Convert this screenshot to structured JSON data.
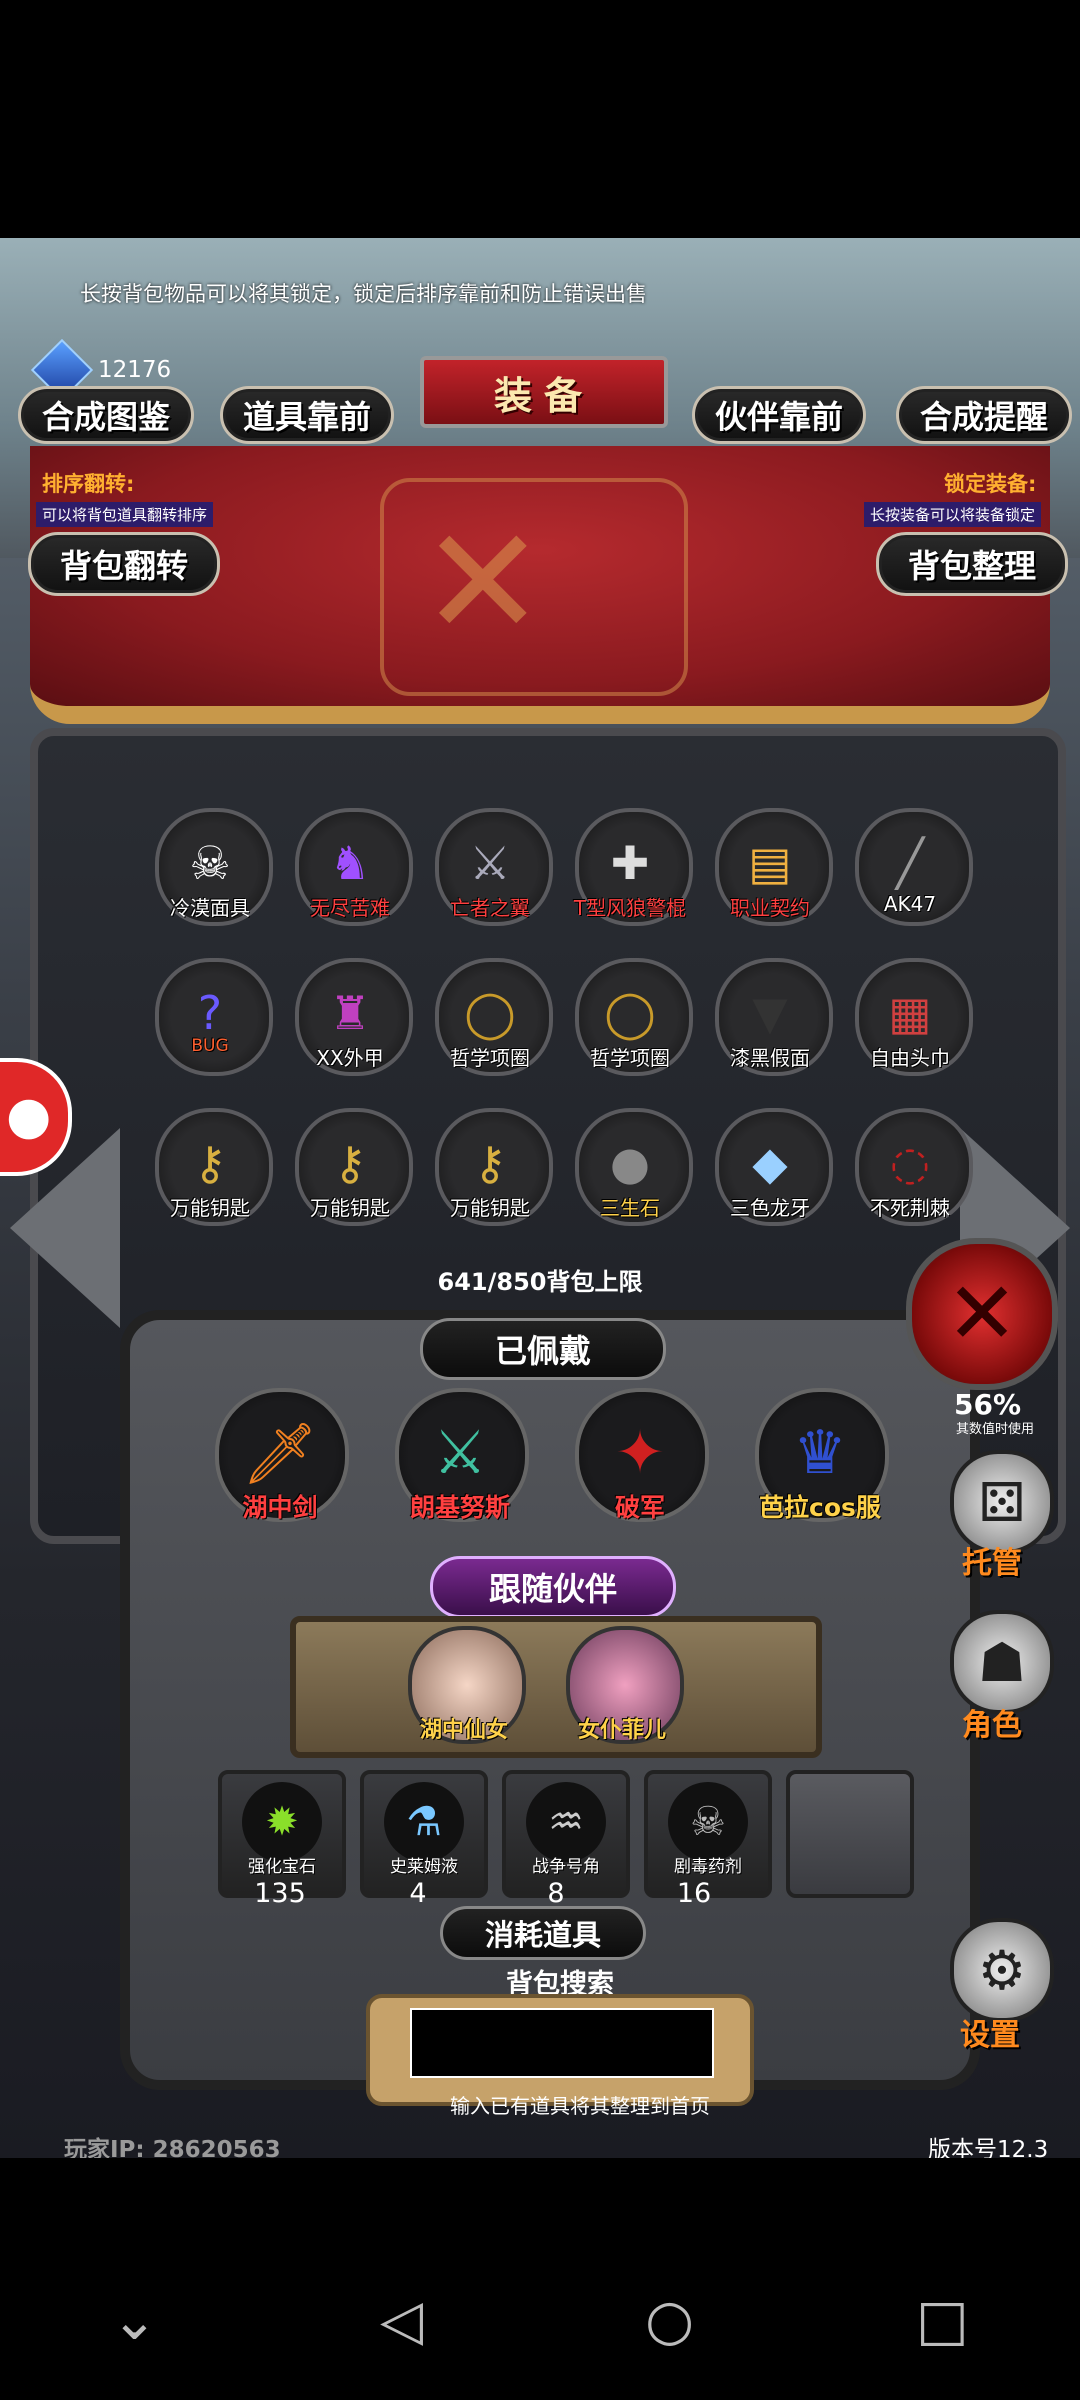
{
  "tip_text": "长按背包物品可以将其锁定，锁定后排序靠前和防止错误出售",
  "currency": {
    "icon": "blue-gem-icon",
    "value": "12176"
  },
  "top_buttons": {
    "synthesis_catalog": "合成图鉴",
    "items_first": "道具靠前",
    "title": "装备",
    "companions_first": "伙伴靠前",
    "synthesis_reminder": "合成提醒"
  },
  "left_info": {
    "label": "排序翻转:",
    "desc": "可以将背包道具翻转排序"
  },
  "right_info": {
    "label": "锁定装备:",
    "desc": "长按装备可以将装备锁定"
  },
  "flip_button": "背包翻转",
  "sort_button": "背包整理",
  "inventory": [
    {
      "label": "冷漠面具",
      "icon": "mask-icon",
      "color": "white"
    },
    {
      "label": "无尽苦难",
      "icon": "knight-icon",
      "color": "red"
    },
    {
      "label": "亡者之翼",
      "icon": "dragon-wing-icon",
      "color": "red"
    },
    {
      "label": "T型风狼警棍",
      "icon": "baton-icon",
      "color": "red"
    },
    {
      "label": "职业契约",
      "icon": "scroll-icon",
      "color": "red"
    },
    {
      "label": "AK47",
      "icon": "rifle-icon",
      "color": "white"
    },
    {
      "label": "",
      "icon": "bug-icon",
      "color": "white"
    },
    {
      "label": "XX外甲",
      "icon": "armor-icon",
      "color": "white"
    },
    {
      "label": "哲学项圈",
      "icon": "collar-icon",
      "color": "white"
    },
    {
      "label": "哲学项圈",
      "icon": "collar-icon",
      "color": "white"
    },
    {
      "label": "漆黑假面",
      "icon": "shorts-icon",
      "color": "white"
    },
    {
      "label": "自由头巾",
      "icon": "bandana-icon",
      "color": "white"
    },
    {
      "label": "万能钥匙",
      "icon": "key-icon",
      "color": "white"
    },
    {
      "label": "万能钥匙",
      "icon": "key-icon",
      "color": "white"
    },
    {
      "label": "万能钥匙",
      "icon": "key-icon",
      "color": "white"
    },
    {
      "label": "三生石",
      "icon": "stone-icon",
      "color": "gold"
    },
    {
      "label": "三色龙牙",
      "icon": "fang-icon",
      "color": "white"
    },
    {
      "label": "不死荆棘",
      "icon": "thorn-icon",
      "color": "white"
    }
  ],
  "bug_label": "BUG",
  "capacity": "641/850背包上限",
  "equipped_title": "已佩戴",
  "equipped": [
    {
      "label": "湖中剑",
      "icon": "sword-icon"
    },
    {
      "label": "朗基努斯",
      "icon": "spear-icon"
    },
    {
      "label": "破军",
      "icon": "red-blade-icon"
    },
    {
      "label": "芭拉cos服",
      "icon": "costume-icon"
    }
  ],
  "companion_title": "跟随伙伴",
  "companions": [
    {
      "label": "湖中仙女",
      "icon": "fairy-avatar-icon"
    },
    {
      "label": "女仆菲儿",
      "icon": "maid-avatar-icon"
    }
  ],
  "consumables": [
    {
      "label": "强化宝石",
      "count": "135",
      "icon": "green-gem-icon"
    },
    {
      "label": "史莱姆液",
      "count": "4",
      "icon": "potion-icon"
    },
    {
      "label": "战争号角",
      "count": "8",
      "icon": "horn-icon"
    },
    {
      "label": "剧毒药剂",
      "count": "16",
      "icon": "poison-icon"
    }
  ],
  "consumables_title": "消耗道具",
  "search": {
    "label": "背包搜索",
    "hint": "输入已有道具将其整理到首页"
  },
  "player_ip": "玩家IP: 28620563",
  "version": "版本号12.3",
  "right_side": {
    "percent": "56%",
    "usage": "其数值时使用",
    "dice_label": "托管",
    "role_label": "角色",
    "settings_label": "设置"
  },
  "colors": {
    "red": "#ff4040",
    "gold": "#ffd24a",
    "orange": "#ff8a1e",
    "curtain": "#8a1a1f"
  }
}
